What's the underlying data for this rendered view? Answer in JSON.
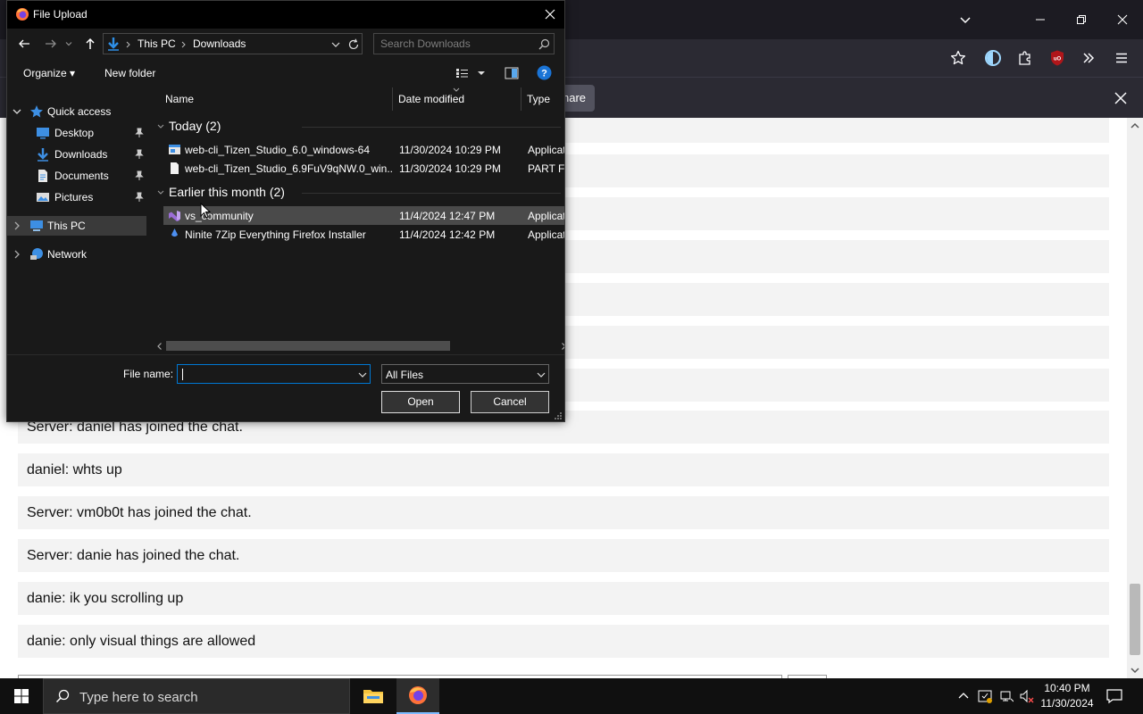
{
  "browser": {
    "notification_share_label": "hare"
  },
  "chat": {
    "messages": [
      "Server: daniel has joined the chat.",
      "daniel: whts up",
      "Server: vm0b0t has joined the chat.",
      "Server: danie has joined the chat.",
      "danie: ik you scrolling up",
      "danie: only visual things are allowed"
    ]
  },
  "dialog": {
    "title": "File Upload",
    "breadcrumbs": [
      "This PC",
      "Downloads"
    ],
    "search_placeholder": "Search Downloads",
    "commands": {
      "organize": "Organize",
      "new_folder": "New folder"
    },
    "nav_pane": {
      "quick_access": "Quick access",
      "items": [
        "Desktop",
        "Downloads",
        "Documents",
        "Pictures"
      ],
      "this_pc": "This PC",
      "network": "Network"
    },
    "columns": {
      "name": "Name",
      "date": "Date modified",
      "type": "Type"
    },
    "groups": [
      {
        "label": "Today (2)",
        "files": [
          {
            "name": "web-cli_Tizen_Studio_6.0_windows-64",
            "date": "11/30/2024 10:29 PM",
            "type": "Application"
          },
          {
            "name": "web-cli_Tizen_Studio_6.9FuV9qNW.0_win...",
            "date": "11/30/2024 10:29 PM",
            "type": "PART File"
          }
        ]
      },
      {
        "label": "Earlier this month (2)",
        "files": [
          {
            "name": "vs_community",
            "date": "11/4/2024 12:47 PM",
            "type": "Application"
          },
          {
            "name": "Ninite 7Zip Everything Firefox Installer",
            "date": "11/4/2024 12:42 PM",
            "type": "Application"
          }
        ]
      }
    ],
    "file_name_label": "File name:",
    "file_name_value": "",
    "file_type": "All Files",
    "open_label": "Open",
    "cancel_label": "Cancel"
  },
  "taskbar": {
    "search_text": "Type here to search",
    "time": "10:40 PM",
    "date": "11/30/2024"
  }
}
